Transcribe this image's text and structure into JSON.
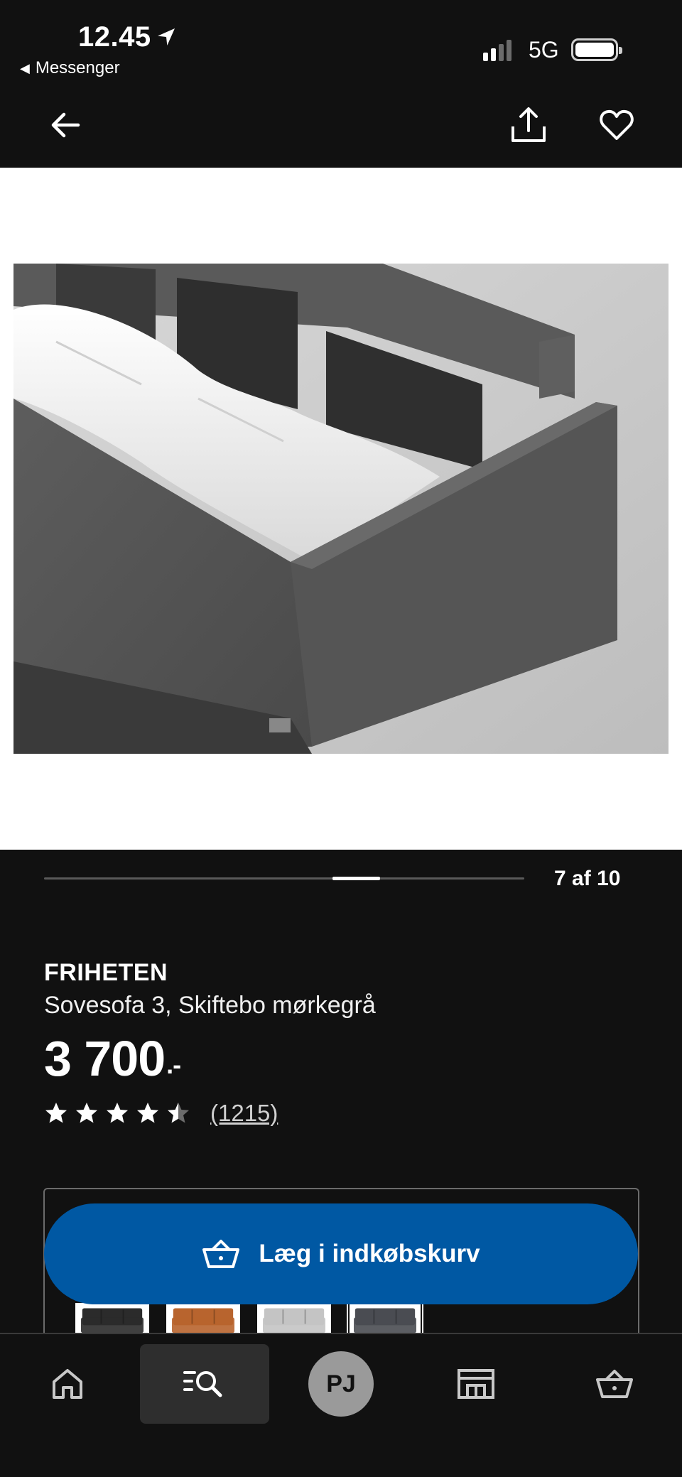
{
  "status_bar": {
    "time": "12.45",
    "back_app": "Messenger",
    "network": "5G"
  },
  "toolbar": {
    "back_icon": "arrow-left-icon",
    "share_icon": "share-icon",
    "favorite_icon": "heart-icon"
  },
  "gallery": {
    "counter": "7 af 10",
    "current_index": 7,
    "total": 10
  },
  "product": {
    "brand": "FRIHETEN",
    "description": "Sovesofa 3, Skiftebo mørkegrå",
    "price": "3 700",
    "price_suffix": ".-",
    "rating": 4.5,
    "rating_max": 5,
    "reviews": "(1215)"
  },
  "variants": [
    {
      "color": "#2b2b2b"
    },
    {
      "color": "#b8642e"
    },
    {
      "color": "#c4c4c4"
    },
    {
      "color": "#4a4c52"
    }
  ],
  "cart_button": {
    "label": "Læg i indkøbskurv",
    "color": "#0058a3"
  },
  "bottom_nav": {
    "home_icon": "home-icon",
    "search_icon": "search-list-icon",
    "profile_initials": "PJ",
    "stores_icon": "store-icon",
    "cart_icon": "basket-icon"
  }
}
